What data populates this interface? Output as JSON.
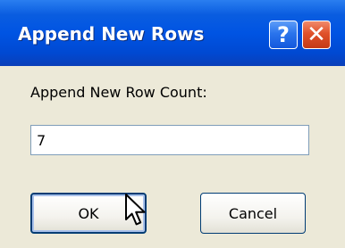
{
  "window": {
    "title": "Append New Rows",
    "help_glyph": "?",
    "close_glyph": "✕",
    "titlebar_color": "#0054e3",
    "close_button_color": "#e0512a",
    "client_color": "#ece9d8"
  },
  "form": {
    "label": "Append New Row Count:",
    "count_value": "7"
  },
  "buttons": {
    "ok_label": "OK",
    "cancel_label": "Cancel",
    "default_button": "ok"
  },
  "pointer": {
    "icon": "arrow-cursor-icon",
    "hovering": "ok-button"
  }
}
